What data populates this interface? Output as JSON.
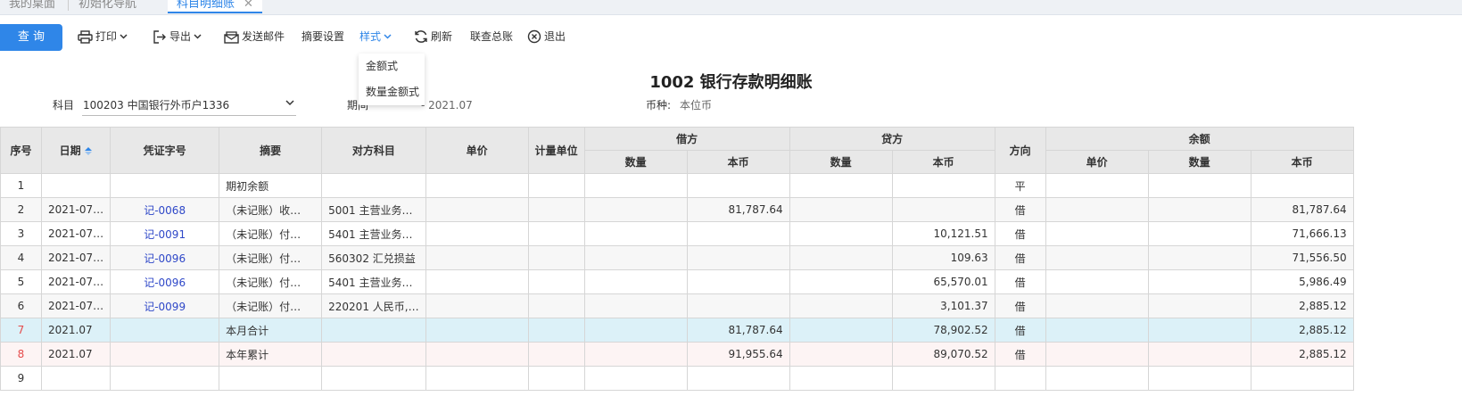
{
  "tabs": [
    {
      "label": "我的桌面"
    },
    {
      "label": "初始化导航"
    },
    {
      "label": "科目明细账"
    }
  ],
  "toolbar": {
    "query_label": "查 询",
    "print_label": "打印",
    "export_label": "导出",
    "send_mail_label": "发送邮件",
    "summary_settings_label": "摘要设置",
    "style_label": "样式",
    "refresh_label": "刷新",
    "linked_ledger_label": "联查总账",
    "exit_label": "退出"
  },
  "style_menu": {
    "items": [
      "金额式",
      "数量金额式"
    ]
  },
  "title": "1002 银行存款明细账",
  "filters": {
    "subject_label": "科目",
    "subject_value": "100203 中国银行外币户1336",
    "period_label": "期间",
    "period_value": "2021.07 - 2021.07",
    "period_visible_end": "- 2021.07",
    "currency_label": "币种:",
    "currency_value": "本位币"
  },
  "table": {
    "headers": {
      "seq": "序号",
      "date": "日期",
      "voucher": "凭证字号",
      "summary": "摘要",
      "counter_account": "对方科目",
      "unit_price": "单价",
      "unit": "计量单位",
      "debit": "借方",
      "credit": "贷方",
      "direction": "方向",
      "balance": "余额",
      "qty": "数量",
      "amount": "本币"
    },
    "rows": [
      {
        "seq": "1",
        "date": "",
        "voucher": "",
        "summary": "期初余额",
        "counter": "",
        "debit_amt": "",
        "credit_amt": "",
        "dir": "平",
        "bal_amt": ""
      },
      {
        "seq": "2",
        "date": "2021-07…",
        "voucher": "记-0068",
        "summary": "（未记账）收…",
        "counter": "5001 主营业务…",
        "debit_amt": "81,787.64",
        "credit_amt": "",
        "dir": "借",
        "bal_amt": "81,787.64"
      },
      {
        "seq": "3",
        "date": "2021-07…",
        "voucher": "记-0091",
        "summary": "（未记账）付…",
        "counter": "5401 主营业务…",
        "debit_amt": "",
        "credit_amt": "10,121.51",
        "dir": "借",
        "bal_amt": "71,666.13"
      },
      {
        "seq": "4",
        "date": "2021-07…",
        "voucher": "记-0096",
        "summary": "（未记账）付…",
        "counter": "560302 汇兑损益",
        "debit_amt": "",
        "credit_amt": "109.63",
        "dir": "借",
        "bal_amt": "71,556.50"
      },
      {
        "seq": "5",
        "date": "2021-07…",
        "voucher": "记-0096",
        "summary": "（未记账）付…",
        "counter": "5401 主营业务…",
        "debit_amt": "",
        "credit_amt": "65,570.01",
        "dir": "借",
        "bal_amt": "5,986.49"
      },
      {
        "seq": "6",
        "date": "2021-07…",
        "voucher": "记-0099",
        "summary": "（未记账）付…",
        "counter": "220201 人民币,…",
        "debit_amt": "",
        "credit_amt": "3,101.37",
        "dir": "借",
        "bal_amt": "2,885.12"
      },
      {
        "seq": "7",
        "date": "2021.07",
        "voucher": "",
        "summary": "本月合计",
        "counter": "",
        "debit_amt": "81,787.64",
        "credit_amt": "78,902.52",
        "dir": "借",
        "bal_amt": "2,885.12"
      },
      {
        "seq": "8",
        "date": "2021.07",
        "voucher": "",
        "summary": "本年累计",
        "counter": "",
        "debit_amt": "91,955.64",
        "credit_amt": "89,070.52",
        "dir": "借",
        "bal_amt": "2,885.12"
      },
      {
        "seq": "9",
        "date": "",
        "voucher": "",
        "summary": "",
        "counter": "",
        "debit_amt": "",
        "credit_amt": "",
        "dir": "",
        "bal_amt": ""
      }
    ]
  },
  "colors": {
    "accent": "#2f86e8",
    "header_bg": "#e8e8e8",
    "total_row_bg": "#dcf1f8",
    "ytd_row_bg": "#fdf4f4",
    "voucher_link": "#2f48c8"
  }
}
